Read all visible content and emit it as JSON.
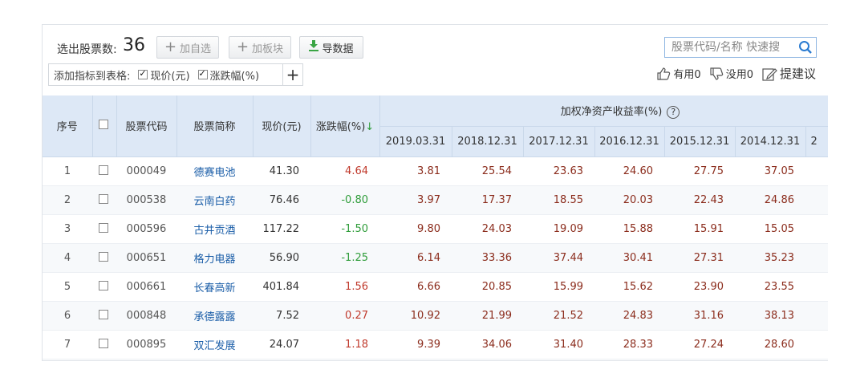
{
  "toolbar": {
    "count_label": "选出股票数:",
    "count_value": "36",
    "add_watchlist": "加自选",
    "add_sector": "加板块",
    "export": "导数据",
    "indicator_label": "添加指标到表格:",
    "indicator_price": "现价(元)",
    "indicator_change": "涨跌幅(%)"
  },
  "search": {
    "placeholder": "股票代码/名称 快速搜"
  },
  "feedback": {
    "useful": "有用0",
    "useless": "没用0",
    "suggest": "提建议"
  },
  "table": {
    "headers": {
      "seq": "序号",
      "code": "股票代码",
      "name": "股票简称",
      "price": "现价(元)",
      "change": "涨跌幅(%)",
      "roe_group": "加权净资产收益率(%)",
      "sort_arrow": "↓"
    },
    "years": [
      "2019.03.31",
      "2018.12.31",
      "2017.12.31",
      "2016.12.31",
      "2015.12.31",
      "2014.12.31",
      "2"
    ],
    "rows": [
      {
        "seq": "1",
        "code": "000049",
        "name": "德赛电池",
        "price": "41.30",
        "change": "4.64",
        "dir": "up",
        "roe": [
          "3.81",
          "25.54",
          "23.63",
          "24.60",
          "27.75",
          "37.05"
        ]
      },
      {
        "seq": "2",
        "code": "000538",
        "name": "云南白药",
        "price": "76.46",
        "change": "-0.80",
        "dir": "down",
        "roe": [
          "3.97",
          "17.37",
          "18.55",
          "20.03",
          "22.43",
          "24.86"
        ]
      },
      {
        "seq": "3",
        "code": "000596",
        "name": "古井贡酒",
        "price": "117.22",
        "change": "-1.50",
        "dir": "down",
        "roe": [
          "9.80",
          "24.03",
          "19.09",
          "15.88",
          "15.91",
          "15.05"
        ]
      },
      {
        "seq": "4",
        "code": "000651",
        "name": "格力电器",
        "price": "56.90",
        "change": "-1.25",
        "dir": "down",
        "roe": [
          "6.14",
          "33.36",
          "37.44",
          "30.41",
          "27.31",
          "35.23"
        ]
      },
      {
        "seq": "5",
        "code": "000661",
        "name": "长春高新",
        "price": "401.84",
        "change": "1.56",
        "dir": "up",
        "roe": [
          "6.66",
          "20.85",
          "15.99",
          "15.62",
          "23.90",
          "23.55"
        ]
      },
      {
        "seq": "6",
        "code": "000848",
        "name": "承德露露",
        "price": "7.52",
        "change": "0.27",
        "dir": "up",
        "roe": [
          "10.92",
          "21.99",
          "21.52",
          "24.83",
          "31.16",
          "38.13"
        ]
      },
      {
        "seq": "7",
        "code": "000895",
        "name": "双汇发展",
        "price": "24.07",
        "change": "1.18",
        "dir": "up",
        "roe": [
          "9.39",
          "34.06",
          "31.40",
          "28.33",
          "27.24",
          "28.60"
        ]
      }
    ]
  },
  "colors": {
    "up": "#c0392b",
    "down": "#2f9d3a",
    "link": "#1b5ea8",
    "header_bg": "#dde8f6"
  }
}
